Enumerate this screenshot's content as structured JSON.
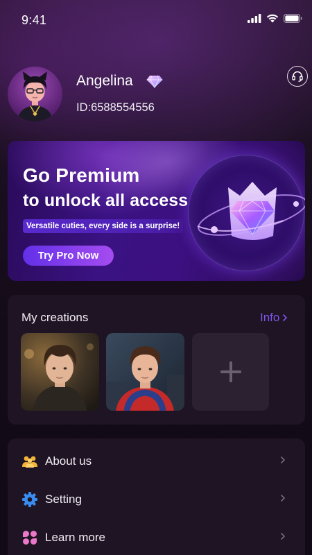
{
  "status_bar": {
    "time": "9:41",
    "icons": [
      "signal-icon",
      "wifi-icon",
      "battery-icon"
    ]
  },
  "profile": {
    "name": "Angelina",
    "id_text": "ID:6588554556",
    "badge_icon": "diamond-vip-icon",
    "support_icon": "headset-icon"
  },
  "premium_banner": {
    "title_line_1": "Go Premium",
    "title_line_2": "to unlock all access",
    "tagline": "Versatile cuties, every side is a surprise!",
    "button_label": "Try Pro Now",
    "graphic_icon": "crown-diamond-icon"
  },
  "creations": {
    "title": "My creations",
    "info_label": "Info",
    "items": [
      {
        "icon": "creation-thumbnail"
      },
      {
        "icon": "creation-thumbnail"
      }
    ],
    "add_icon": "plus-icon"
  },
  "menu": {
    "items": [
      {
        "label": "About us",
        "icon": "people-icon"
      },
      {
        "label": "Setting",
        "icon": "gear-icon"
      },
      {
        "label": "Learn more",
        "icon": "flower-icon"
      }
    ]
  },
  "colors": {
    "accent": "#7d55e8",
    "background": "#140b18",
    "card": "#1f1424",
    "pro_button_start": "#6330e8",
    "pro_button_end": "#a54cf0"
  }
}
